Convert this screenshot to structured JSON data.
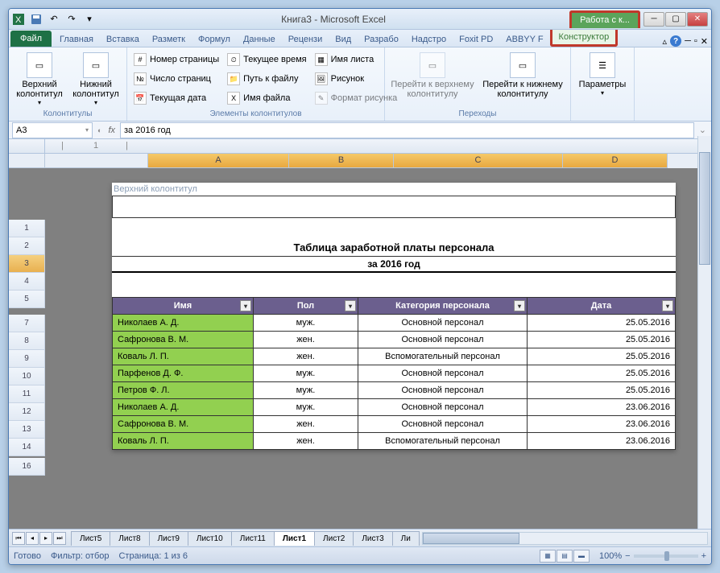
{
  "titlebar": {
    "title": "Книга3  -  Microsoft Excel",
    "context_tab": "Работа с к..."
  },
  "tabs": {
    "file": "Файл",
    "list": [
      "Главная",
      "Вставка",
      "Разметк",
      "Формул",
      "Данные",
      "Рецензи",
      "Вид",
      "Разрабо",
      "Надстро",
      "Foxit PD",
      "ABBYY F"
    ],
    "context": "Конструктор"
  },
  "ribbon": {
    "g1": {
      "label": "Колонтитулы",
      "btn1": "Верхний колонтитул",
      "btn2": "Нижний колонтитул"
    },
    "g2": {
      "label": "Элементы колонтитулов",
      "items": [
        "Номер страницы",
        "Число страниц",
        "Текущая дата",
        "Текущее время",
        "Путь к файлу",
        "Имя файла",
        "Имя листа",
        "Рисунок",
        "Формат рисунка"
      ]
    },
    "g3": {
      "label": "Переходы",
      "btn1": "Перейти к верхнему колонтитулу",
      "btn2": "Перейти к нижнему колонтитулу"
    },
    "g4": {
      "label": "",
      "btn": "Параметры"
    }
  },
  "formula_bar": {
    "cell": "A3",
    "value": "за 2016 год"
  },
  "sheet": {
    "header_label": "Верхний колонтитул",
    "title": "Таблица заработной платы персонала",
    "subtitle": "за 2016 год",
    "columns": [
      "Имя",
      "Пол",
      "Категория персонала",
      "Дата"
    ],
    "selected_row_header": "3",
    "row_headers": [
      "1",
      "2",
      "3",
      "4",
      "5",
      "7",
      "8",
      "9",
      "10",
      "11",
      "12",
      "13",
      "14",
      "16"
    ],
    "rows": [
      {
        "name": "Николаев А. Д.",
        "sex": "муж.",
        "cat": "Основной персонал",
        "date": "25.05.2016"
      },
      {
        "name": "Сафронова В. М.",
        "sex": "жен.",
        "cat": "Основной персонал",
        "date": "25.05.2016"
      },
      {
        "name": "Коваль Л. П.",
        "sex": "жен.",
        "cat": "Вспомогательный персонал",
        "date": "25.05.2016"
      },
      {
        "name": "Парфенов Д. Ф.",
        "sex": "муж.",
        "cat": "Основной персонал",
        "date": "25.05.2016"
      },
      {
        "name": "Петров Ф. Л.",
        "sex": "муж.",
        "cat": "Основной персонал",
        "date": "25.05.2016"
      },
      {
        "name": "Николаев А. Д.",
        "sex": "муж.",
        "cat": "Основной персонал",
        "date": "23.06.2016"
      },
      {
        "name": "Сафронова В. М.",
        "sex": "жен.",
        "cat": "Основной персонал",
        "date": "23.06.2016"
      },
      {
        "name": "Коваль Л. П.",
        "sex": "жен.",
        "cat": "Вспомогательный персонал",
        "date": "23.06.2016"
      }
    ]
  },
  "sheet_tabs": {
    "list": [
      "Лист5",
      "Лист8",
      "Лист9",
      "Лист10",
      "Лист11",
      "Лист1",
      "Лист2",
      "Лист3",
      "Ли"
    ],
    "active": "Лист1"
  },
  "status": {
    "ready": "Готово",
    "filter": "Фильтр: отбор",
    "page": "Страница: 1 из 6",
    "zoom": "100%"
  },
  "col_letters": [
    "A",
    "B",
    "C",
    "D"
  ]
}
